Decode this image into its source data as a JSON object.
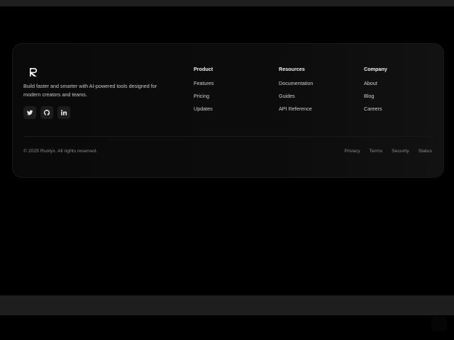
{
  "brand": {
    "tagline": "Build faster and smarter with AI-powered tools designed for modern creators and teams."
  },
  "socials": [
    {
      "icon": "twitter-icon"
    },
    {
      "icon": "github-icon"
    },
    {
      "icon": "linkedin-icon"
    }
  ],
  "columns": [
    {
      "heading": "Product",
      "links": [
        "Features",
        "Pricing",
        "Updates"
      ]
    },
    {
      "heading": "Resources",
      "links": [
        "Documentation",
        "Guides",
        "API Reference"
      ]
    },
    {
      "heading": "Company",
      "links": [
        "About",
        "Blog",
        "Careers"
      ]
    }
  ],
  "copyright": "© 2025 Runlyx. All rights reserved.",
  "legal": [
    "Privacy",
    "Terms",
    "Security",
    "Status"
  ]
}
